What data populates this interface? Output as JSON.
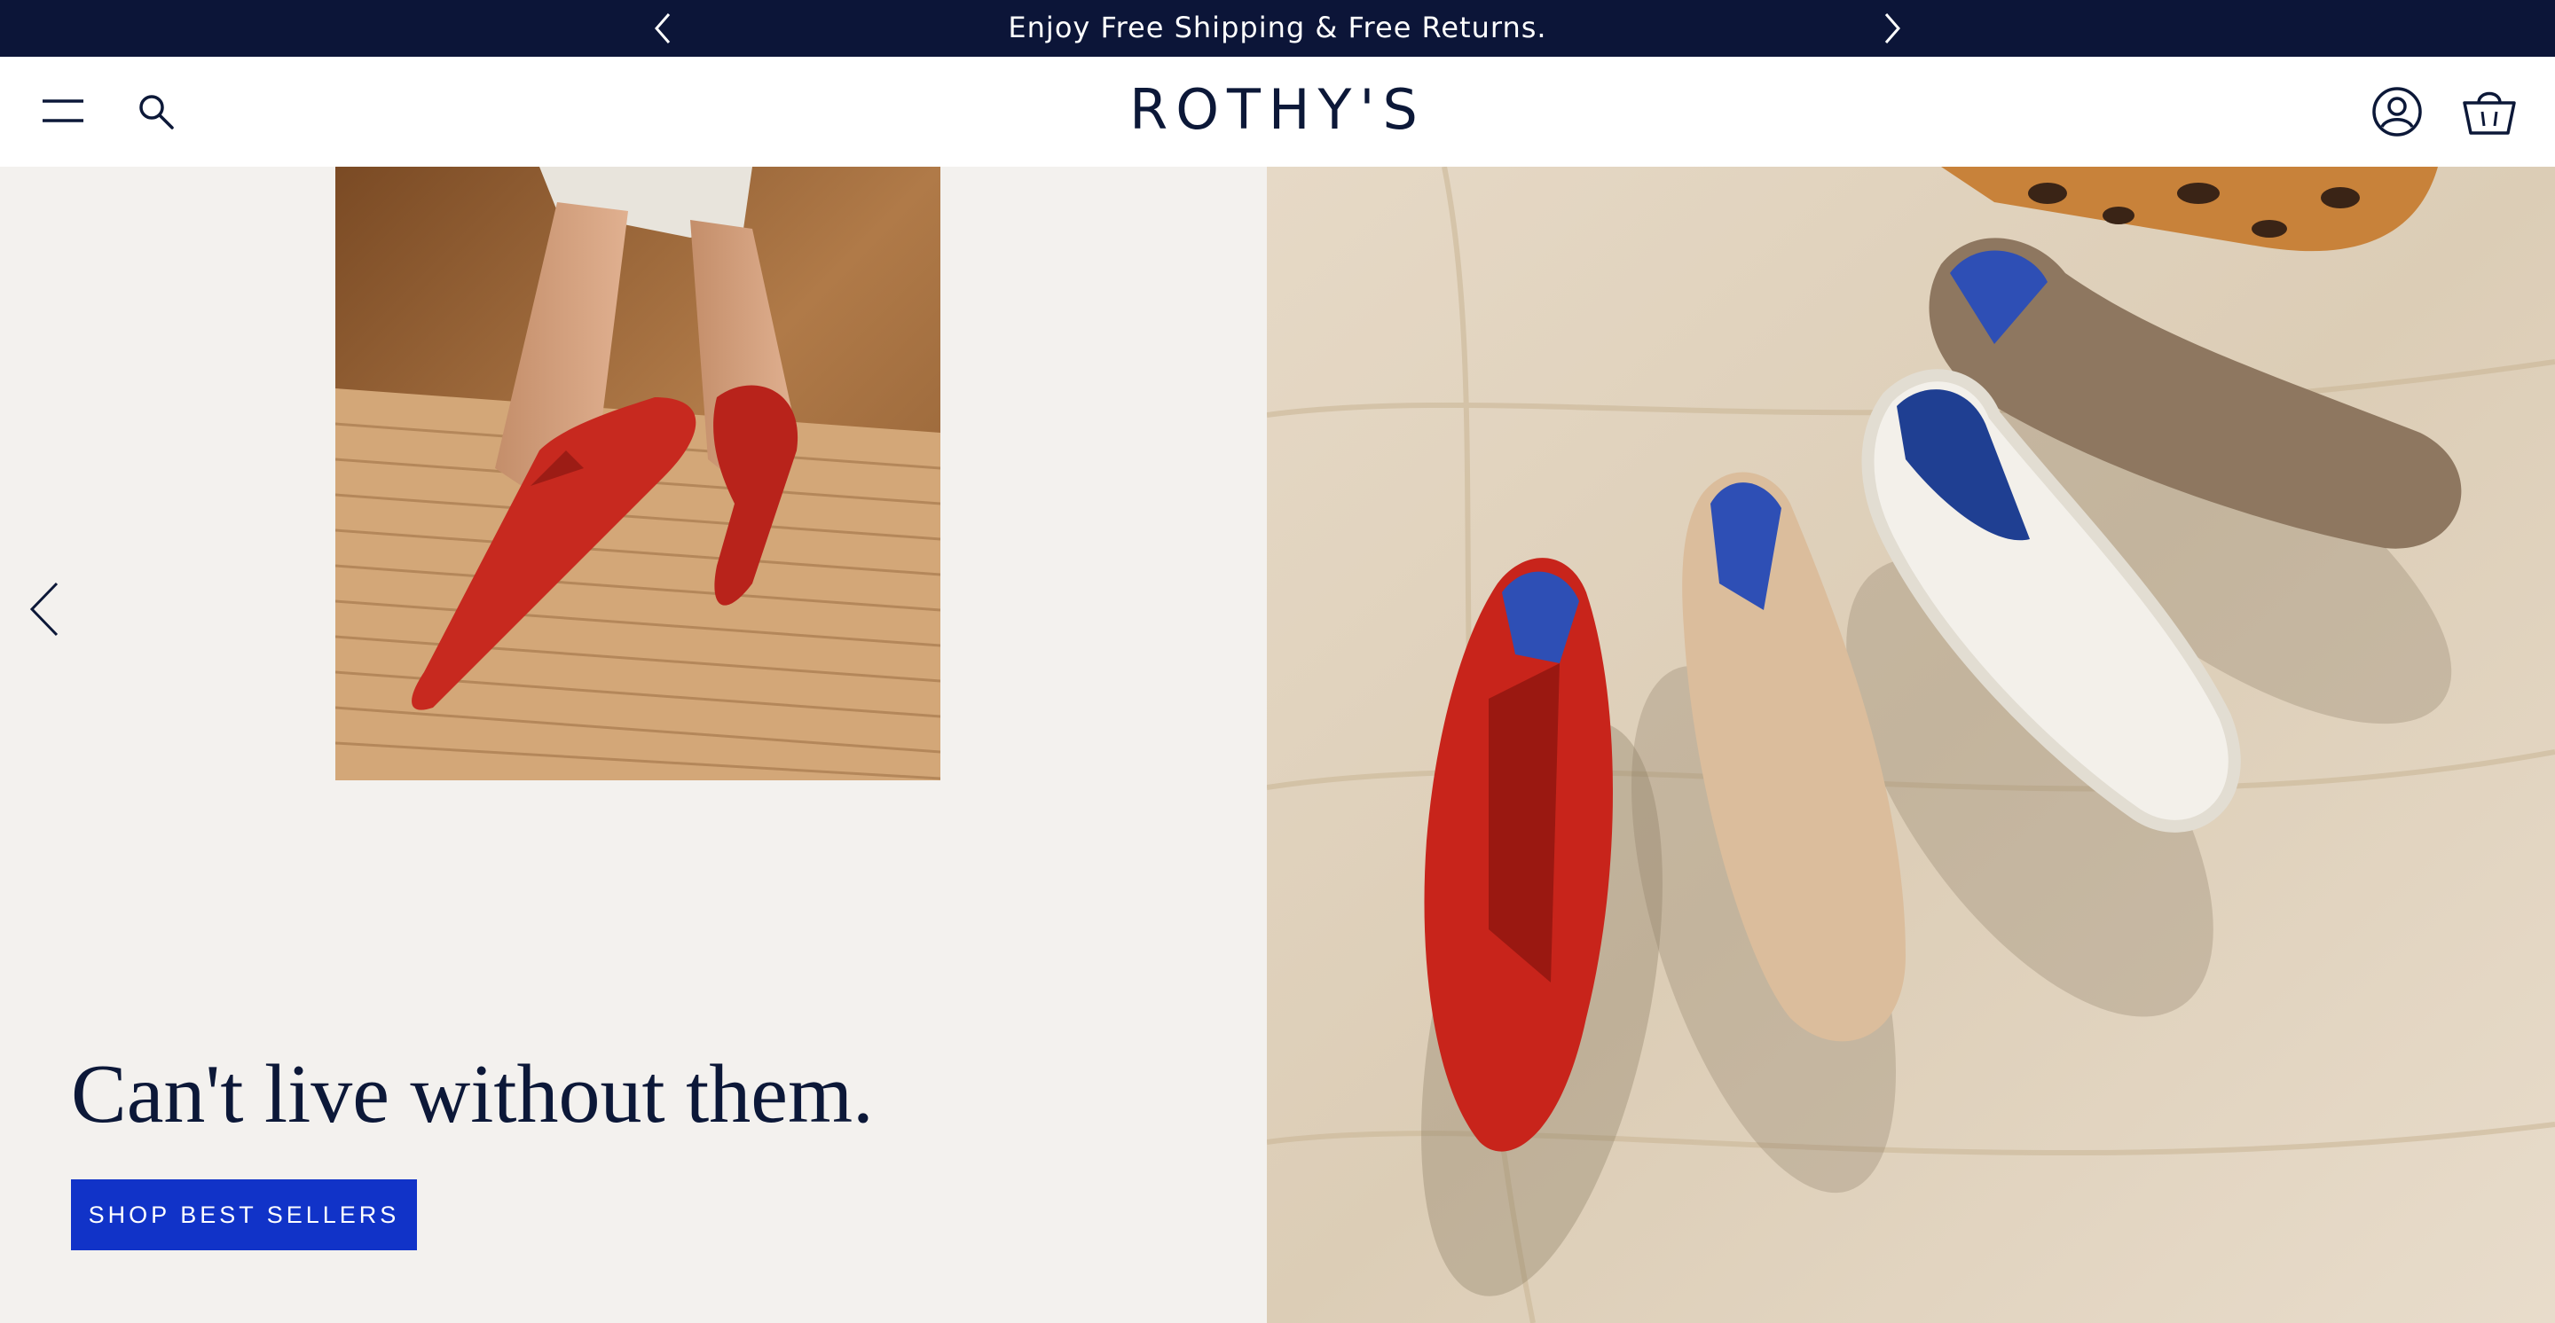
{
  "announcement": {
    "text": "Enjoy Free Shipping & Free Returns.",
    "prev_icon": "chevron-left-icon",
    "next_icon": "chevron-right-icon"
  },
  "header": {
    "logo": "ROTHY'S",
    "menu_icon": "hamburger-menu-icon",
    "search_icon": "search-icon",
    "account_icon": "account-icon",
    "cart_icon": "shopping-bag-icon"
  },
  "hero": {
    "headline": "Can't live without them.",
    "cta_label": "SHOP BEST SELLERS",
    "carousel_prev_icon": "chevron-left-icon",
    "left_photo": "red knit pointed flats on wooden stool",
    "right_photo": "assorted knit flats and slip-on sneakers on marble"
  },
  "colors": {
    "announcement_bg": "#0c1538",
    "brand_navy": "#0c1838",
    "cta_blue": "#1133c8",
    "hero_bg": "#f3f1ee"
  }
}
